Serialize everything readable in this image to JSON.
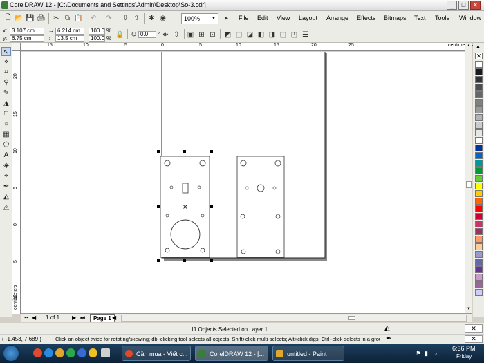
{
  "window": {
    "title": "CorelDRAW 12 - [C:\\Documents and Settings\\Admin\\Desktop\\So-3.cdr]"
  },
  "toolbar": {
    "zoom": "100%"
  },
  "menus": [
    "File",
    "Edit",
    "View",
    "Layout",
    "Arrange",
    "Effects",
    "Bitmaps",
    "Text",
    "Tools",
    "Window"
  ],
  "property_bar": {
    "x_label": "x:",
    "x_value": "3.107 cm",
    "y_label": "y:",
    "y_value": "6.75 cm",
    "w_value": "6.214 cm",
    "h_value": "13.5 cm",
    "scale_x": "100.0",
    "scale_y": "100.0",
    "scale_unit": "%",
    "rotation": "0.0",
    "rotation_unit": "°"
  },
  "rulers": {
    "unit": "centimeters",
    "h_ticks": [
      "15",
      "10",
      "5",
      "0",
      "5",
      "10",
      "15",
      "20",
      "25"
    ],
    "v_ticks": [
      "20",
      "15",
      "10",
      "5",
      "0",
      "5",
      "10",
      "15",
      "20"
    ],
    "v_unit": "centimeters"
  },
  "page_nav": {
    "count": "1 of 1",
    "tab": "Page 1"
  },
  "status": {
    "selection": "11 Objects Selected on Layer 1",
    "coords": "( -1.453, 7.689 )",
    "hint": "Click an object twice for rotating/skewing; dbl-clicking tool selects all objects; Shift+click multi-selects; Alt+click digs; Ctrl+click selects in a group"
  },
  "palette_colors": [
    "#ffffff",
    "#1a1a1a",
    "#333333",
    "#4d4d4d",
    "#666666",
    "#808080",
    "#999999",
    "#b3b3b3",
    "#cccccc",
    "#e6e6e6",
    "#ffffff",
    "#003399",
    "#0066cc",
    "#009999",
    "#009933",
    "#66cc33",
    "#ffff00",
    "#ffcc00",
    "#ff6600",
    "#ff0000",
    "#cc0033",
    "#cc3366",
    "#993366",
    "#ff9966",
    "#ffcc99",
    "#9999cc",
    "#6666aa",
    "#663399",
    "#cc99cc",
    "#996699",
    "#ccccff"
  ],
  "taskbar": {
    "items": [
      "Cần mua - Viết c...",
      "CorelDRAW 12 - [...",
      "untitled - Paint"
    ],
    "time": "6:36 PM",
    "day": "Friday"
  }
}
